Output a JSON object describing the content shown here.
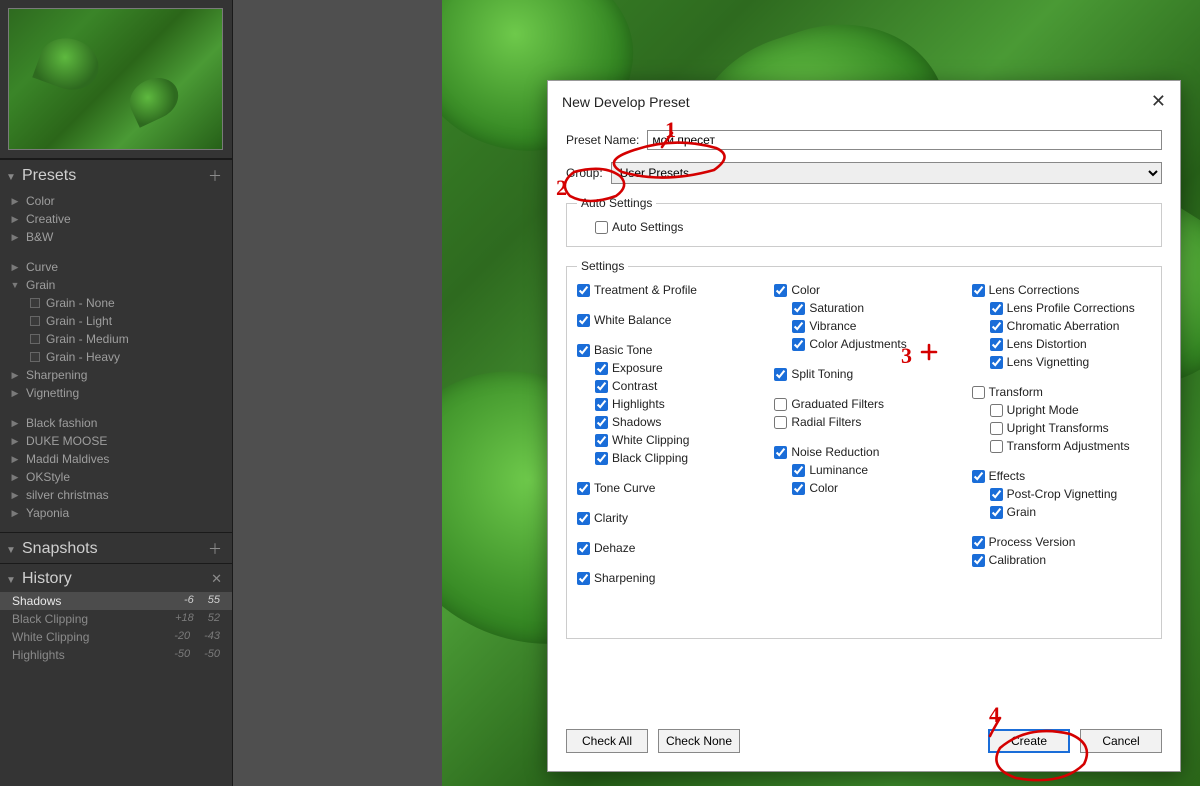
{
  "panels": {
    "presets": {
      "title": "Presets"
    },
    "snapshots": {
      "title": "Snapshots"
    },
    "history": {
      "title": "History"
    }
  },
  "presets_tree": {
    "top": [
      "Color",
      "Creative",
      "B&W"
    ],
    "mid": {
      "curve": "Curve",
      "grain": "Grain",
      "grain_subs": [
        "Grain - None",
        "Grain - Light",
        "Grain - Medium",
        "Grain - Heavy"
      ],
      "sharpening": "Sharpening",
      "vignetting": "Vignetting"
    },
    "user": [
      "Black fashion",
      "DUKE MOOSE",
      "Maddi Maldives",
      "OKStyle",
      "silver christmas",
      "Yaponia"
    ]
  },
  "history": [
    {
      "name": "Shadows",
      "a": "-6",
      "b": "55",
      "sel": true
    },
    {
      "name": "Black Clipping",
      "a": "+18",
      "b": "52",
      "sel": false
    },
    {
      "name": "White Clipping",
      "a": "-20",
      "b": "-43",
      "sel": false
    },
    {
      "name": "Highlights",
      "a": "-50",
      "b": "-50",
      "sel": false
    }
  ],
  "dialog": {
    "title": "New Develop Preset",
    "preset_name_label": "Preset Name:",
    "preset_name_value": "мой пресет",
    "group_label": "Group:",
    "group_value": "User Presets",
    "auto_legend": "Auto Settings",
    "auto_check": "Auto Settings",
    "settings_legend": "Settings",
    "buttons": {
      "check_all": "Check All",
      "check_none": "Check None",
      "create": "Create",
      "cancel": "Cancel"
    }
  },
  "settings": {
    "col1": [
      {
        "label": "Treatment & Profile",
        "checked": true,
        "gap": true
      },
      {
        "label": "White Balance",
        "checked": true,
        "gap": true
      },
      {
        "label": "Basic Tone",
        "checked": true
      },
      {
        "label": "Exposure",
        "checked": true,
        "indent": true
      },
      {
        "label": "Contrast",
        "checked": true,
        "indent": true
      },
      {
        "label": "Highlights",
        "checked": true,
        "indent": true
      },
      {
        "label": "Shadows",
        "checked": true,
        "indent": true
      },
      {
        "label": "White Clipping",
        "checked": true,
        "indent": true
      },
      {
        "label": "Black Clipping",
        "checked": true,
        "indent": true,
        "gap": true
      },
      {
        "label": "Tone Curve",
        "checked": true,
        "gap": true
      },
      {
        "label": "Clarity",
        "checked": true,
        "gap": true
      },
      {
        "label": "Dehaze",
        "checked": true,
        "gap": true
      },
      {
        "label": "Sharpening",
        "checked": true
      }
    ],
    "col2": [
      {
        "label": "Color",
        "checked": true
      },
      {
        "label": "Saturation",
        "checked": true,
        "indent": true
      },
      {
        "label": "Vibrance",
        "checked": true,
        "indent": true
      },
      {
        "label": "Color Adjustments",
        "checked": true,
        "indent": true,
        "gap": true
      },
      {
        "label": "Split Toning",
        "checked": true,
        "gap": true
      },
      {
        "label": "Graduated Filters",
        "checked": false
      },
      {
        "label": "Radial Filters",
        "checked": false,
        "gap": true
      },
      {
        "label": "Noise Reduction",
        "checked": true
      },
      {
        "label": "Luminance",
        "checked": true,
        "indent": true
      },
      {
        "label": "Color",
        "checked": true,
        "indent": true
      }
    ],
    "col3": [
      {
        "label": "Lens Corrections",
        "checked": true
      },
      {
        "label": "Lens Profile Corrections",
        "checked": true,
        "indent": true
      },
      {
        "label": "Chromatic Aberration",
        "checked": true,
        "indent": true
      },
      {
        "label": "Lens Distortion",
        "checked": true,
        "indent": true
      },
      {
        "label": "Lens Vignetting",
        "checked": true,
        "indent": true,
        "gap": true
      },
      {
        "label": "Transform",
        "checked": false
      },
      {
        "label": "Upright Mode",
        "checked": false,
        "indent": true
      },
      {
        "label": "Upright Transforms",
        "checked": false,
        "indent": true
      },
      {
        "label": "Transform Adjustments",
        "checked": false,
        "indent": true,
        "gap": true
      },
      {
        "label": "Effects",
        "checked": true
      },
      {
        "label": "Post-Crop Vignetting",
        "checked": true,
        "indent": true
      },
      {
        "label": "Grain",
        "checked": true,
        "indent": true,
        "gap": true
      },
      {
        "label": "Process Version",
        "checked": true
      },
      {
        "label": "Calibration",
        "checked": true
      }
    ]
  },
  "annotations": {
    "one": "1",
    "two": "2",
    "three": "3",
    "four": "4"
  }
}
